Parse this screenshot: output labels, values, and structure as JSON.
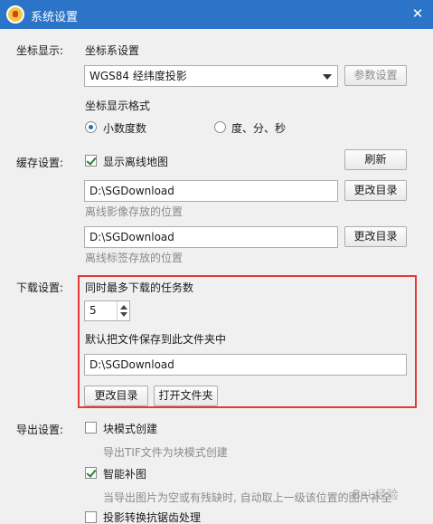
{
  "window": {
    "title": "系统设置"
  },
  "coord_display": {
    "section_label": "坐标显示:",
    "system_label": "坐标系设置",
    "system_value": "WGS84 经纬度投影",
    "param_button": "参数设置",
    "format_label": "坐标显示格式",
    "format_options": [
      "小数度数",
      "度、分、秒"
    ],
    "format_selected": 0
  },
  "cache": {
    "section_label": "缓存设置:",
    "show_offline_label": "显示离线地图",
    "show_offline_checked": true,
    "refresh_button": "刷新",
    "image_path": "D:\\SGDownload",
    "image_change_button": "更改目录",
    "image_hint": "离线影像存放的位置",
    "label_path": "D:\\SGDownload",
    "label_change_button": "更改目录",
    "label_hint": "离线标签存放的位置"
  },
  "download": {
    "section_label": "下载设置:",
    "max_tasks_label": "同时最多下载的任务数",
    "max_tasks_value": "5",
    "save_folder_label": "默认把文件保存到此文件夹中",
    "save_folder_path": "D:\\SGDownload",
    "change_button": "更改目录",
    "open_button": "打开文件夹"
  },
  "export": {
    "section_label": "导出设置:",
    "block_mode_label": "块模式创建",
    "block_mode_checked": false,
    "block_mode_hint": "导出TIF文件为块模式创建",
    "smart_fill_label": "智能补图",
    "smart_fill_checked": true,
    "smart_fill_hint": "当导出图片为空或有残缺时, 自动取上一级该位置的图片补全",
    "antialias_label": "投影转换抗锯齿处理",
    "antialias_checked": false
  },
  "watermark": "Bai 经验",
  "colors": {
    "titlebar": "#2b74c7",
    "highlight": "#e53935"
  }
}
